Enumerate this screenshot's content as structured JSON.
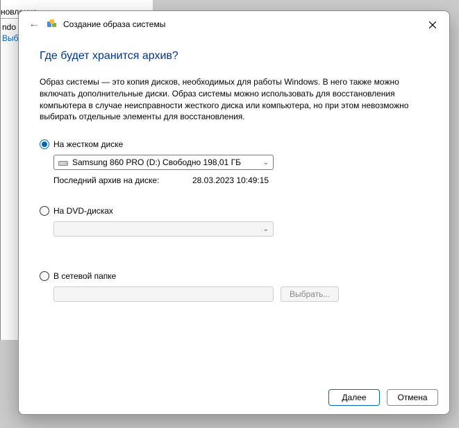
{
  "background": {
    "text1": "новление",
    "text2": "ndo",
    "text3": "Выб"
  },
  "dialog": {
    "title": "Создание образа системы",
    "question": "Где будет хранится архив?",
    "description": "Образ системы — это копия дисков, необходимых для работы Windows. В него также можно включать дополнительные диски. Образ системы можно использовать для восстановления компьютера в случае неисправности жесткого диска или компьютера, но при этом невозможно выбирать отдельные элементы для восстановления.",
    "options": {
      "hard_disk": {
        "label": "На жестком диске",
        "dropdown_value": "Samsung 860 PRO (D:)  Свободно 198,01 ГБ",
        "last_archive_label": "Последний архив на диске:",
        "last_archive_value": "28.03.2023 10:49:15"
      },
      "dvd": {
        "label": "На DVD-дисках"
      },
      "network": {
        "label": "В сетевой папке",
        "browse_label": "Выбрать..."
      }
    },
    "buttons": {
      "next": "Далее",
      "cancel": "Отмена"
    }
  }
}
